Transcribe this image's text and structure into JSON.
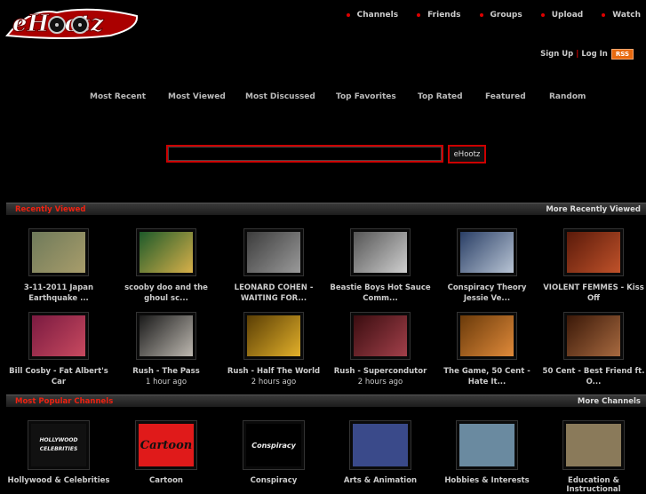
{
  "logo": {
    "text": "eHootz"
  },
  "nav": [
    "Channels",
    "Friends",
    "Groups",
    "Upload",
    "Watch"
  ],
  "auth": {
    "signup": "Sign Up",
    "login": "Log In",
    "rss": "RSS"
  },
  "categories": [
    "Most Recent",
    "Most Viewed",
    "Most Discussed",
    "Top Favorites",
    "Top Rated",
    "Featured",
    "Random"
  ],
  "search": {
    "value": "",
    "button": "eHootz"
  },
  "recent": {
    "title": "Recently Viewed",
    "more": "More Recently Viewed",
    "videos": [
      {
        "title": "3-11-2011 Japan Earthquake ...",
        "meta": "",
        "colors": [
          "#6f7a5a",
          "#a89d6b"
        ]
      },
      {
        "title": "scooby doo and the ghoul sc...",
        "meta": "",
        "colors": [
          "#1d5a2a",
          "#d8b04a"
        ]
      },
      {
        "title": "LEONARD COHEN - WAITING FOR...",
        "meta": "",
        "colors": [
          "#3c3c3c",
          "#9a9a9a"
        ]
      },
      {
        "title": "Beastie Boys Hot Sauce Comm...",
        "meta": "",
        "colors": [
          "#555",
          "#cfcfcf"
        ]
      },
      {
        "title": "Conspiracy Theory Jessie Ve...",
        "meta": "",
        "colors": [
          "#2a3f66",
          "#b8c4d4"
        ]
      },
      {
        "title": "VIOLENT FEMMES - Kiss Off",
        "meta": "",
        "colors": [
          "#5a1a0a",
          "#c0522a"
        ]
      },
      {
        "title": "Bill Cosby - Fat Albert's Car",
        "meta": "",
        "colors": [
          "#7a1a40",
          "#c84a60"
        ]
      },
      {
        "title": "Rush - The Pass",
        "meta": "1 hour ago",
        "colors": [
          "#1a1a1a",
          "#bdb8b0"
        ]
      },
      {
        "title": "Rush - Half The World",
        "meta": "2 hours ago",
        "colors": [
          "#5a3e05",
          "#e2b02a"
        ]
      },
      {
        "title": "Rush - Supercondutor",
        "meta": "2 hours ago",
        "colors": [
          "#3a0d10",
          "#a2404a"
        ]
      },
      {
        "title": "The Game, 50 Cent - Hate It...",
        "meta": "",
        "colors": [
          "#6a3a0a",
          "#e08a3a"
        ]
      },
      {
        "title": "50 Cent - Best Friend ft. O...",
        "meta": "",
        "colors": [
          "#3a1808",
          "#a86a40"
        ]
      }
    ]
  },
  "channels_section": {
    "title": "Most Popular Channels",
    "more": "More Channels",
    "items": [
      {
        "name": "Hollywood & Celebrities",
        "thumb_text": "HOLLYWOOD CELEBRITIES",
        "bg": "#111",
        "fg": "#eee"
      },
      {
        "name": "Cartoon",
        "thumb_text": "Cartoon",
        "bg": "#e01a1a",
        "fg": "#111"
      },
      {
        "name": "Conspiracy",
        "thumb_text": "Conspiracy",
        "bg": "#000",
        "fg": "#eee"
      },
      {
        "name": "Arts & Animation",
        "thumb_text": "",
        "bg": "#3a4a8a",
        "fg": "#eee"
      },
      {
        "name": "Hobbies & Interests",
        "thumb_text": "",
        "bg": "#6a8aa0",
        "fg": "#eee"
      },
      {
        "name": "Education & Instructional",
        "thumb_text": "",
        "bg": "#8a7a5a",
        "fg": "#eee"
      }
    ]
  }
}
